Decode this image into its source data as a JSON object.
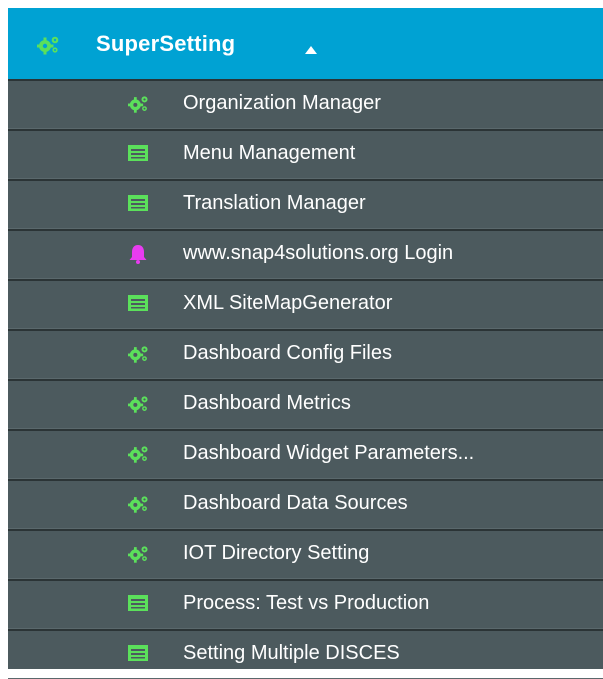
{
  "header": {
    "label": "SuperSetting",
    "icon": "cogs-icon",
    "caret": "caret-up-icon"
  },
  "colors": {
    "header_bg": "#00a2d3",
    "item_bg": "#4c5a5e",
    "green": "#5be05b",
    "magenta": "#e83cf0"
  },
  "items": [
    {
      "label": "Organization Manager",
      "icon": "cogs-icon"
    },
    {
      "label": "Menu Management",
      "icon": "list-icon"
    },
    {
      "label": "Translation Manager",
      "icon": "list-icon"
    },
    {
      "label": "www.snap4solutions.org Login",
      "icon": "bell-icon"
    },
    {
      "label": "XML SiteMapGenerator",
      "icon": "list-icon"
    },
    {
      "label": "Dashboard Config Files",
      "icon": "cogs-icon"
    },
    {
      "label": "Dashboard Metrics",
      "icon": "cogs-icon"
    },
    {
      "label": "Dashboard Widget Parameters...",
      "icon": "cogs-icon"
    },
    {
      "label": "Dashboard Data Sources",
      "icon": "cogs-icon"
    },
    {
      "label": "IOT Directory Setting",
      "icon": "cogs-icon"
    },
    {
      "label": "Process: Test vs Production",
      "icon": "list-icon"
    },
    {
      "label": "Setting Multiple DISCES",
      "icon": "list-icon"
    }
  ]
}
